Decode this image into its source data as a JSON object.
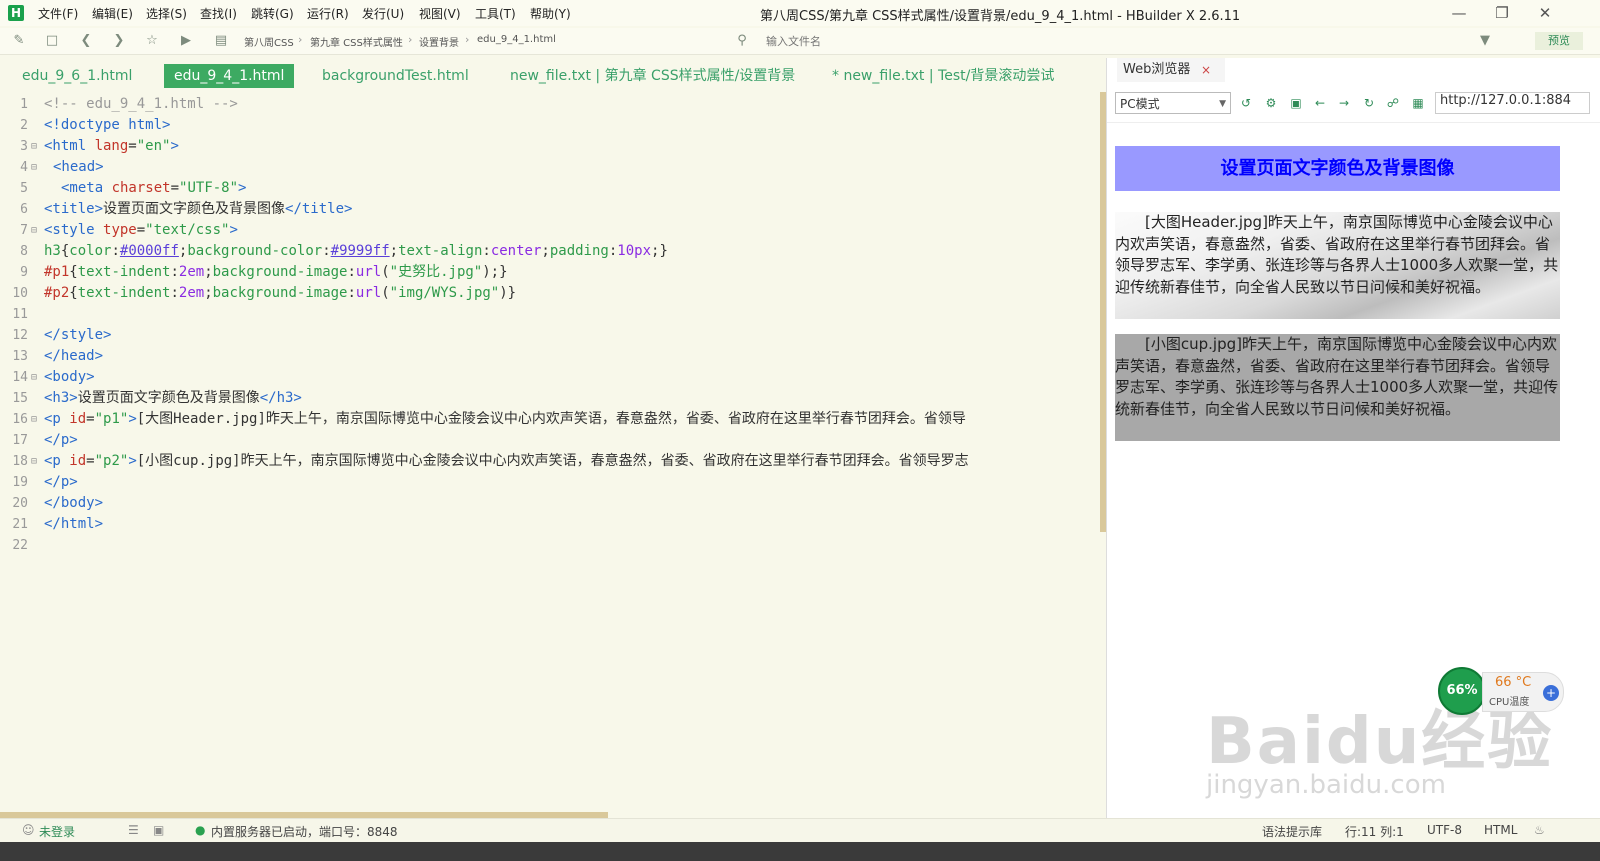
{
  "app": {
    "logo": "H",
    "menu": [
      "文件(F)",
      "编辑(E)",
      "选择(S)",
      "查找(I)",
      "跳转(G)",
      "运行(R)",
      "发行(U)",
      "视图(V)",
      "工具(T)",
      "帮助(Y)"
    ],
    "window_title": "第八周CSS/第九章 CSS样式属性/设置背景/edu_9_4_1.html - HBuilder X 2.6.11"
  },
  "toolbar": {
    "breadcrumb": [
      "第八周CSS",
      "第九章 CSS样式属性",
      "设置背景",
      "edu_9_4_1.html"
    ],
    "file_search_placeholder": "输入文件名",
    "preview_label": "预览"
  },
  "tabs": [
    {
      "label": "edu_9_6_1.html",
      "active": false
    },
    {
      "label": "edu_9_4_1.html",
      "active": true
    },
    {
      "label": "backgroundTest.html",
      "active": false
    },
    {
      "label": "new_file.txt | 第九章 CSS样式属性/设置背景",
      "active": false
    },
    {
      "label": "* new_file.txt | Test/背景滚动尝试",
      "active": false
    }
  ],
  "editor": {
    "lines": [
      {
        "n": "1"
      },
      {
        "n": "2"
      },
      {
        "n": "3"
      },
      {
        "n": "4"
      },
      {
        "n": "5"
      },
      {
        "n": "6"
      },
      {
        "n": "7"
      },
      {
        "n": "8"
      },
      {
        "n": "9"
      },
      {
        "n": "10"
      },
      {
        "n": "11"
      },
      {
        "n": "12"
      },
      {
        "n": "13"
      },
      {
        "n": "14"
      },
      {
        "n": "15"
      },
      {
        "n": "16"
      },
      {
        "n": "17"
      },
      {
        "n": "18"
      },
      {
        "n": "19"
      },
      {
        "n": "20"
      },
      {
        "n": "21"
      },
      {
        "n": "22"
      }
    ],
    "code": {
      "l1": "<!-- edu_9_4_1.html -->",
      "l2": "<!doctype html>",
      "l3a": "<html ",
      "l3b": "lang",
      "l3c": "=",
      "l3d": "\"en\"",
      "l3e": ">",
      "l4": "<head>",
      "l5a": "<meta ",
      "l5b": "charset",
      "l5c": "=",
      "l5d": "\"UTF-8\"",
      "l5e": ">",
      "l6a": "<title>",
      "l6b": "设置页面文字颜色及背景图像",
      "l6c": "</title>",
      "l7a": "<style ",
      "l7b": "type",
      "l7c": "=",
      "l7d": "\"text/css\"",
      "l7e": ">",
      "l8_sel": "h3",
      "l8_p1": "color",
      "l8_v1": "#0000ff",
      "l8_p2": "background-color",
      "l8_v2": "#9999ff",
      "l8_p3": "text-align",
      "l8_v3": "center",
      "l8_p4": "padding",
      "l8_v4": "10px",
      "l9_sel": "#p1",
      "l9_p1": "text-indent",
      "l9_v1": "2em",
      "l9_p2": "background-image",
      "l9_fn": "url",
      "l9_s": "\"史努比.jpg\"",
      "l10_sel": "#p2",
      "l10_p1": "text-indent",
      "l10_v1": "2em",
      "l10_p2": "background-image",
      "l10_fn": "url",
      "l10_s": "\"img/WYS.jpg\"",
      "l12": "</style>",
      "l13": "</head>",
      "l14": "<body>",
      "l15a": "<h3>",
      "l15b": "设置页面文字颜色及背景图像",
      "l15c": "</h3>",
      "l16a": "<p ",
      "l16b": "id",
      "l16c": "=",
      "l16d": "\"p1\"",
      "l16e": ">",
      "l16f": "[大图Header.jpg]昨天上午，南京国际博览中心金陵会议中心内欢声笑语，春意盎然，省委、省政府在这里举行春节团拜会。省领导",
      "l17": "</p>",
      "l18a": "<p ",
      "l18b": "id",
      "l18c": "=",
      "l18d": "\"p2\"",
      "l18e": ">",
      "l18f": "[小图cup.jpg]昨天上午，南京国际博览中心金陵会议中心内欢声笑语，春意盎然，省委、省政府在这里举行春节团拜会。省领导罗志",
      "l19": "</p>",
      "l20": "</body>",
      "l21": "</html>"
    }
  },
  "browser": {
    "tab_label": "Web浏览器",
    "close": "×",
    "mode": "PC模式",
    "url": "http://127.0.0.1:884",
    "page": {
      "h3": "设置页面文字颜色及背景图像",
      "p1": "[大图Header.jpg]昨天上午，南京国际博览中心金陵会议中心内欢声笑语，春意盎然，省委、省政府在这里举行春节团拜会。省领导罗志军、李学勇、张连珍等与各界人士1000多人欢聚一堂，共迎传统新春佳节，向全省人民致以节日问候和美好祝福。",
      "p2": "[小图cup.jpg]昨天上午，南京国际博览中心金陵会议中心内欢声笑语，春意盎然，省委、省政府在这里举行春节团拜会。省领导罗志军、李学勇、张连珍等与各界人士1000多人欢聚一堂，共迎传统新春佳节，向全省人民致以节日问候和美好祝福。"
    }
  },
  "cpu_widget": {
    "usage": "66%",
    "temp": "66 °C",
    "label": "CPU温度",
    "plus": "+"
  },
  "watermark": {
    "logo": "Baidu经验",
    "sub": "jingyan.baidu.com"
  },
  "statusbar": {
    "login": "未登录",
    "server": "内置服务器已启动，端口号：8848",
    "syntax": "语法提示库",
    "position": "行:11  列:1",
    "encoding": "UTF-8",
    "language": "HTML"
  },
  "colors": {
    "accent": "#3daa62",
    "h3_bg": "#9999ff",
    "h3_fg": "#0000ff"
  }
}
